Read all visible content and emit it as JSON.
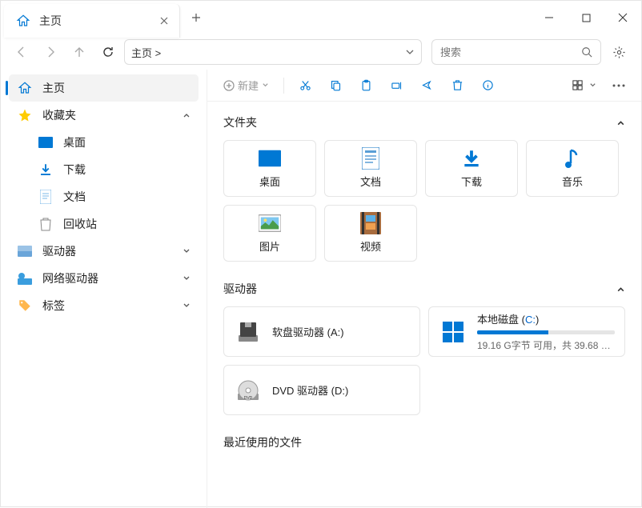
{
  "tab": {
    "title": "主页"
  },
  "nav": {
    "address": "主页 >",
    "search_placeholder": "搜索"
  },
  "toolbar": {
    "new_label": "新建"
  },
  "sidebar": {
    "home": "主页",
    "favorites": "收藏夹",
    "fav_items": [
      {
        "label": "桌面"
      },
      {
        "label": "下载"
      },
      {
        "label": "文档"
      },
      {
        "label": "回收站"
      }
    ],
    "drives": "驱动器",
    "net_drives": "网络驱动器",
    "tags": "标签"
  },
  "sections": {
    "folders": {
      "title": "文件夹"
    },
    "drives": {
      "title": "驱动器"
    },
    "recent": {
      "title": "最近使用的文件"
    }
  },
  "folders": [
    {
      "label": "桌面",
      "icon": "desktop"
    },
    {
      "label": "文档",
      "icon": "documents"
    },
    {
      "label": "下载",
      "icon": "downloads"
    },
    {
      "label": "音乐",
      "icon": "music"
    },
    {
      "label": "图片",
      "icon": "pictures"
    },
    {
      "label": "视频",
      "icon": "videos"
    }
  ],
  "drives_list": [
    {
      "name": "软盘驱动器 (A:)",
      "has_bar": false,
      "icon": "floppy"
    },
    {
      "name_prefix": "本地磁盘 (",
      "name_link": "C:",
      "name_suffix": ")",
      "has_bar": true,
      "fill_pct": 52,
      "sub": "19.16 G字节 可用，共 39.68 G...",
      "icon": "win"
    },
    {
      "name": "DVD 驱动器 (D:)",
      "has_bar": false,
      "icon": "dvd"
    }
  ]
}
